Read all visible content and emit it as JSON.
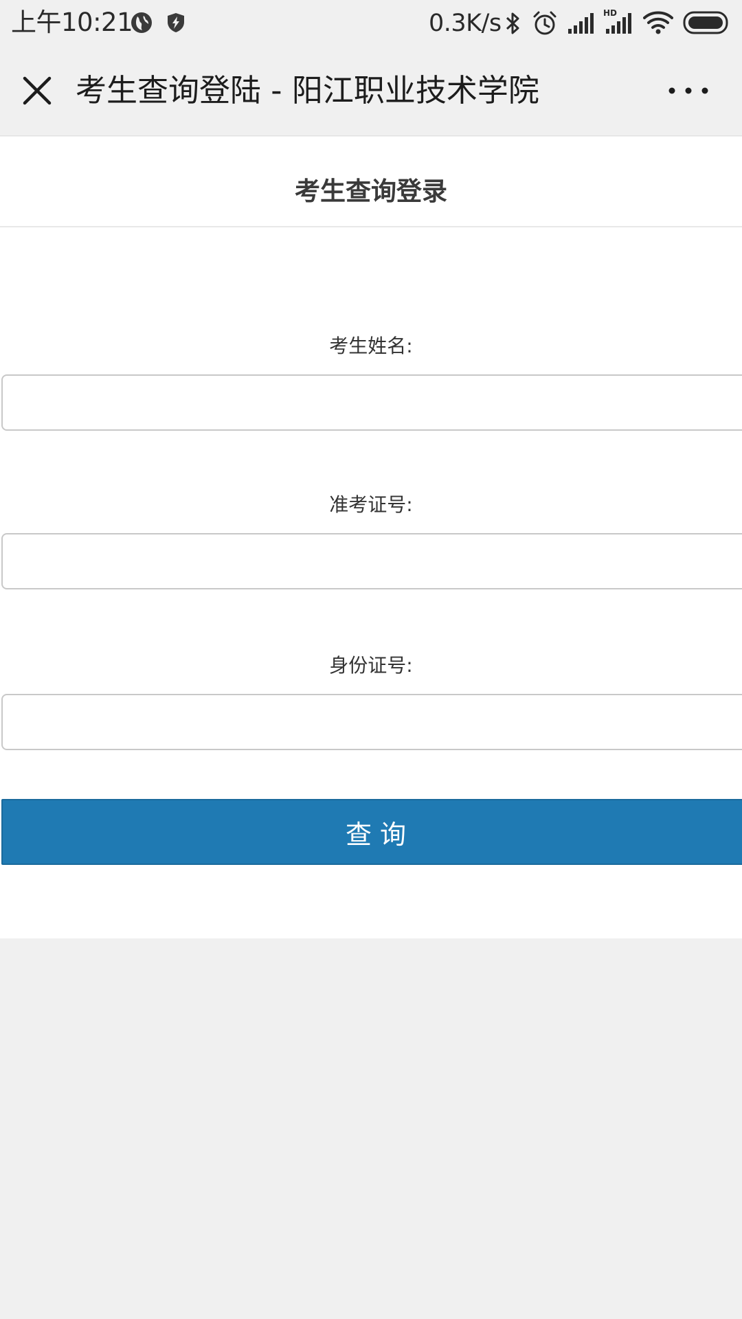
{
  "status_bar": {
    "time": "上午10:21",
    "network_speed": "0.3K/s",
    "left_icons": [
      "globe-icon",
      "shield-bolt-icon"
    ],
    "right_icons": [
      "bluetooth-icon",
      "alarm-icon",
      "signal-icon",
      "hd-signal-icon",
      "wifi-icon",
      "battery-icon"
    ],
    "hd_label": "HD"
  },
  "title_bar": {
    "close_icon": "close-icon",
    "title": "考生查询登陆 - 阳江职业技术学院",
    "more_icon": "more-icon"
  },
  "page": {
    "heading": "考生查询登录",
    "fields": [
      {
        "label": "考生姓名:",
        "value": "",
        "placeholder": ""
      },
      {
        "label": "准考证号:",
        "value": "",
        "placeholder": ""
      },
      {
        "label": "身份证号:",
        "value": "",
        "placeholder": ""
      }
    ],
    "submit_label": "查询"
  },
  "colors": {
    "accent": "#1f7ab3",
    "page_background": "#f0f0f0",
    "card_background": "#ffffff"
  }
}
